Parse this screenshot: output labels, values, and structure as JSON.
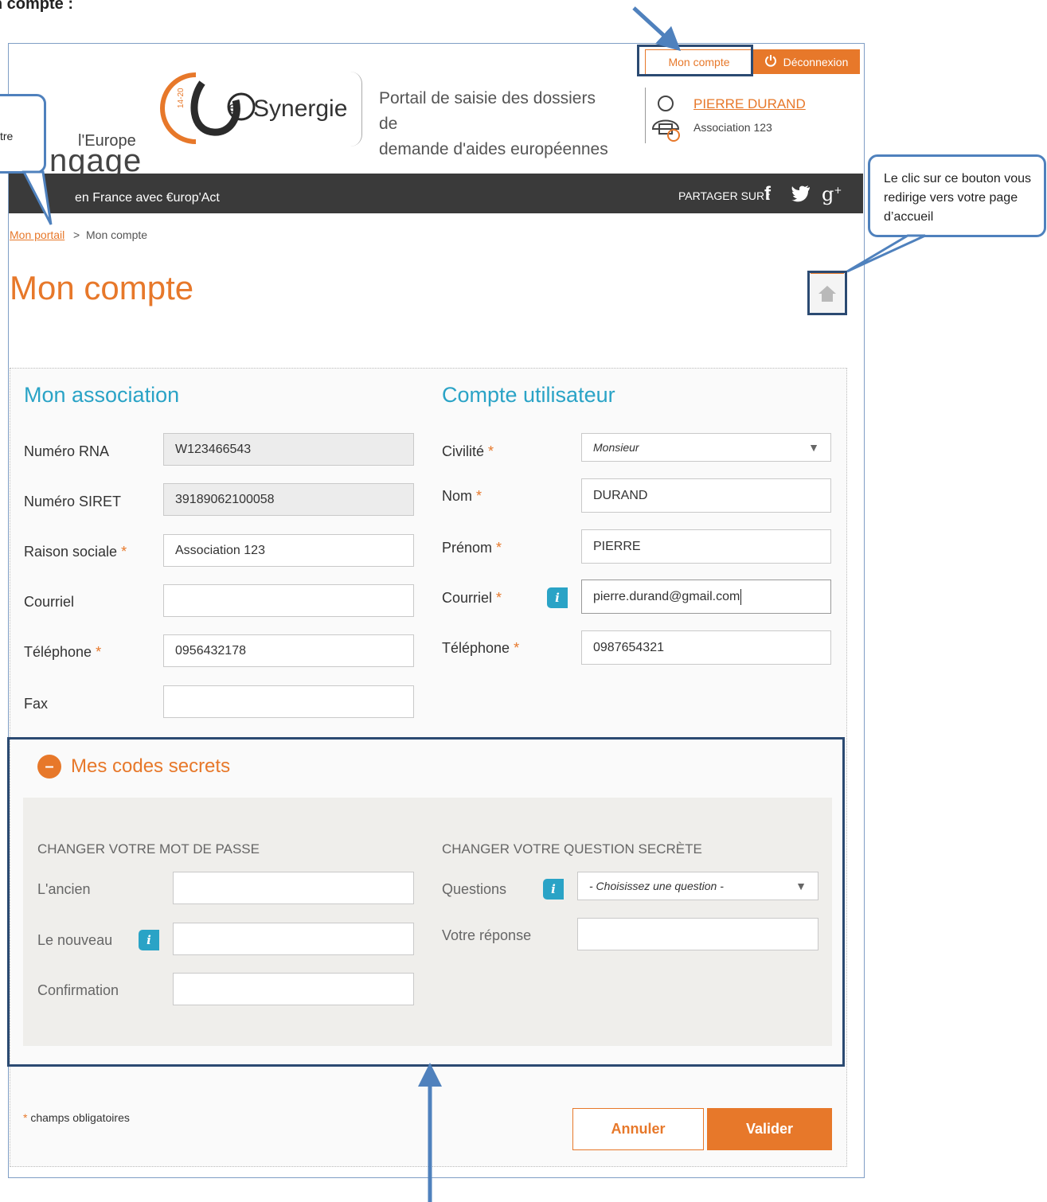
{
  "doc": {
    "heading": "Mon compte :"
  },
  "topbar": {
    "account_label": "Mon compte",
    "logout_label": "Déconnexion"
  },
  "brand": {
    "synergie_name": "Synergie",
    "synergie_badge": "14-20",
    "tagline_line1": "Portail de saisie des dossiers de",
    "tagline_line2": "demande d'aides européennes",
    "europe_small": "l'Europe",
    "engage_big": "ngage",
    "band_text": "en France avec €urop'Act",
    "share_label": "PARTAGER SUR :"
  },
  "user": {
    "name": "PIERRE DURAND",
    "association": "Association 123"
  },
  "breadcrumb": {
    "home": "Mon portail",
    "separator": ">",
    "current": "Mon compte"
  },
  "page": {
    "title": "Mon compte"
  },
  "association": {
    "title": "Mon association",
    "fields": [
      {
        "label": "Numéro RNA",
        "required": false,
        "value": "W123466543",
        "readonly": true
      },
      {
        "label": "Numéro SIRET",
        "required": false,
        "value": "39189062100058",
        "readonly": true
      },
      {
        "label": "Raison sociale",
        "required": true,
        "value": "Association 123",
        "readonly": false
      },
      {
        "label": "Courriel",
        "required": false,
        "value": "",
        "readonly": false
      },
      {
        "label": "Téléphone",
        "required": true,
        "value": "0956432178",
        "readonly": false
      },
      {
        "label": "Fax",
        "required": false,
        "value": "",
        "readonly": false
      }
    ]
  },
  "user_account": {
    "title": "Compte utilisateur",
    "civility_label": "Civilité",
    "civility_value": "Monsieur",
    "nom_label": "Nom",
    "nom_value": "DURAND",
    "prenom_label": "Prénom",
    "prenom_value": "PIERRE",
    "email_label": "Courriel",
    "email_value": "pierre.durand@gmail.com",
    "phone_label": "Téléphone",
    "phone_value": "0987654321"
  },
  "secrets": {
    "title": "Mes codes secrets",
    "password_heading": "CHANGER VOTRE MOT DE PASSE",
    "old_label": "L'ancien",
    "new_label": "Le nouveau",
    "confirm_label": "Confirmation",
    "question_heading": "CHANGER VOTRE QUESTION SECRÈTE",
    "questions_label": "Questions",
    "questions_placeholder": "- Choisissez une question -",
    "answer_label": "Votre réponse"
  },
  "footer": {
    "required_note": "champs obligatoires",
    "required_mark": "*",
    "cancel_label": "Annuler",
    "submit_label": "Valider"
  },
  "callouts": {
    "left_text": "tre",
    "right_text": "Le clic sur ce bouton vous redirige vers votre page d’accueil"
  },
  "info_glyph": "i",
  "colors": {
    "accent": "#e7782a",
    "section_blue": "#2aa3c6",
    "annotation": "#2b4a72"
  }
}
